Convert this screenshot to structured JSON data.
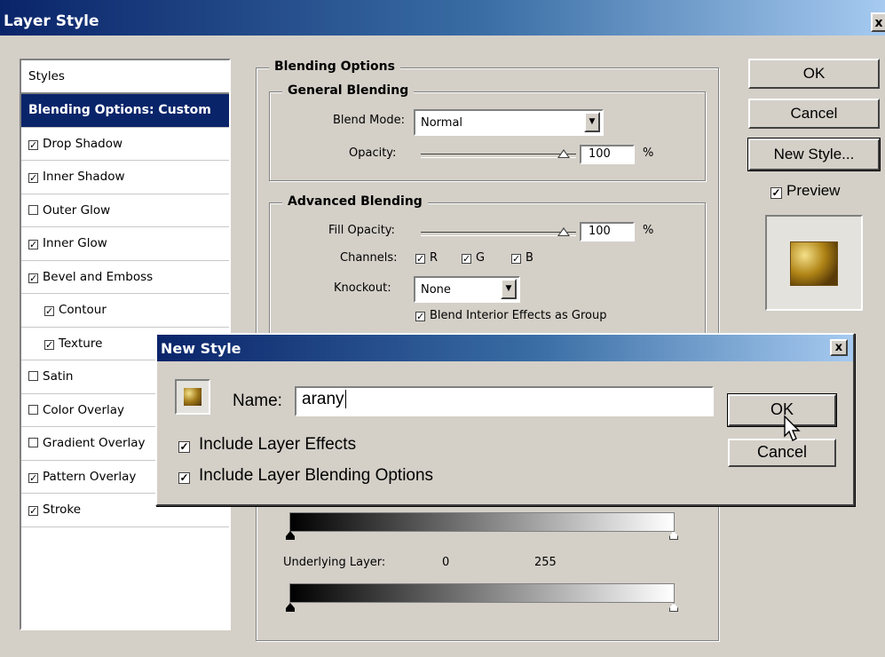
{
  "window": {
    "title": "Layer Style",
    "close_glyph": "x"
  },
  "styles_panel": {
    "header": "Styles",
    "selected": "Blending Options: Custom",
    "items": [
      {
        "label": "Drop Shadow",
        "checked": true,
        "sub": false
      },
      {
        "label": "Inner Shadow",
        "checked": true,
        "sub": false
      },
      {
        "label": "Outer Glow",
        "checked": false,
        "sub": false
      },
      {
        "label": "Inner Glow",
        "checked": true,
        "sub": false
      },
      {
        "label": "Bevel and Emboss",
        "checked": true,
        "sub": false
      },
      {
        "label": "Contour",
        "checked": true,
        "sub": true
      },
      {
        "label": "Texture",
        "checked": true,
        "sub": true
      },
      {
        "label": "Satin",
        "checked": false,
        "sub": false
      },
      {
        "label": "Color Overlay",
        "checked": false,
        "sub": false
      },
      {
        "label": "Gradient Overlay",
        "checked": false,
        "sub": false
      },
      {
        "label": "Pattern Overlay",
        "checked": true,
        "sub": false
      },
      {
        "label": "Stroke",
        "checked": true,
        "sub": false
      }
    ]
  },
  "blending_options": {
    "title": "Blending Options",
    "general": {
      "title": "General Blending",
      "blend_mode_label": "Blend Mode:",
      "blend_mode_value": "Normal",
      "opacity_label": "Opacity:",
      "opacity_value": "100",
      "percent": "%"
    },
    "advanced": {
      "title": "Advanced Blending",
      "fill_opacity_label": "Fill Opacity:",
      "fill_opacity_value": "100",
      "percent": "%",
      "channels_label": "Channels:",
      "channel_r": "R",
      "channel_g": "G",
      "channel_b": "B",
      "knockout_label": "Knockout:",
      "knockout_value": "None",
      "blend_interior_label": "Blend Interior Effects as Group"
    },
    "blend_if": {
      "underlying_label": "Underlying Layer:",
      "underlying_min": "0",
      "underlying_max": "255"
    }
  },
  "right_buttons": {
    "ok": "OK",
    "cancel": "Cancel",
    "new_style": "New Style...",
    "preview_label": "Preview",
    "preview_checked": true
  },
  "new_style_dialog": {
    "title": "New Style",
    "close_glyph": "x",
    "name_label": "Name:",
    "name_value": "arany",
    "include_effects_label": "Include Layer Effects",
    "include_blending_label": "Include Layer Blending Options",
    "ok": "OK",
    "cancel": "Cancel"
  },
  "colors": {
    "title_start": "#0a246a",
    "title_end": "#a6caf0",
    "face": "#d4d0c8",
    "gold": "#c8a020"
  }
}
